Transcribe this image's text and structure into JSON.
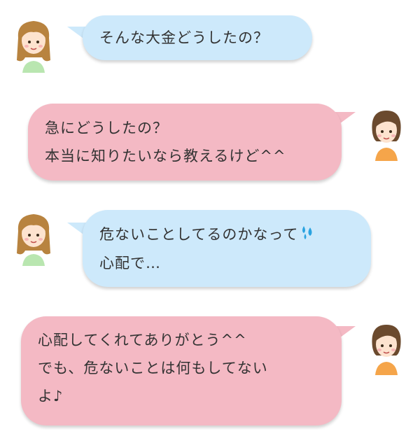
{
  "messages": [
    {
      "side": "left",
      "color": "blue",
      "avatar": "girl-long-hair-avatar",
      "lines": [
        "そんな大金どうしたの？"
      ]
    },
    {
      "side": "right",
      "color": "pink",
      "avatar": "woman-short-hair-avatar",
      "lines": [
        "急にどうしたの？",
        "本当に知りたいなら教えるけど^^"
      ]
    },
    {
      "side": "left",
      "color": "blue",
      "avatar": "girl-long-hair-avatar",
      "lines": [
        "危ないことしてるのかなって",
        "心配で…"
      ],
      "emoji": "sweat-drops-icon"
    },
    {
      "side": "right",
      "color": "pink",
      "avatar": "woman-short-hair-avatar",
      "lines": [
        "心配してくれてありがとう^^",
        "でも、危ないことは何もしてない",
        "よ♪"
      ]
    }
  ],
  "colors": {
    "blue_bubble": "#cde9fb",
    "pink_bubble": "#f4b9c4",
    "text": "#333333"
  }
}
